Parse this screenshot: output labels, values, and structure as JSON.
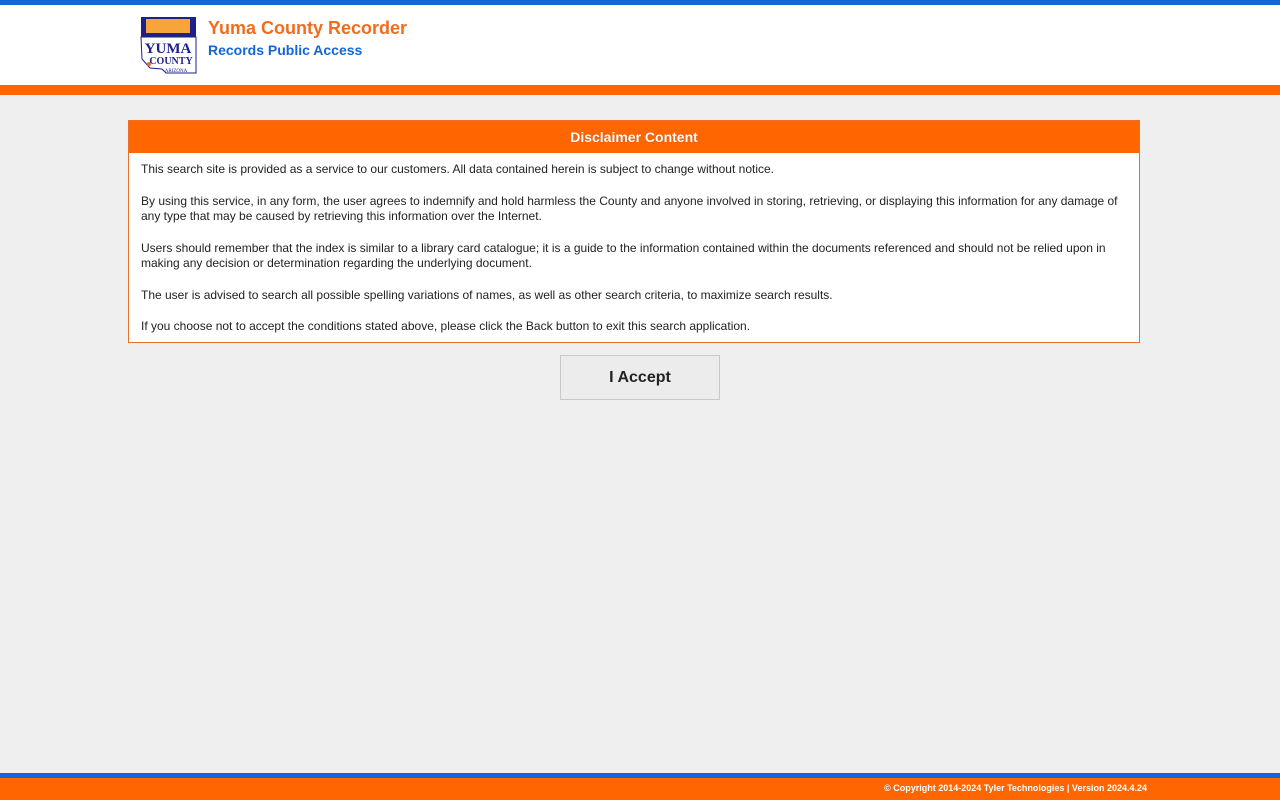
{
  "header": {
    "title": "Yuma County Recorder",
    "subtitle": "Records Public Access",
    "logo": {
      "icon": "yuma-county-seal",
      "text_line1": "YUMA",
      "text_line2": "COUNTY",
      "text_line3": "ARIZONA"
    }
  },
  "disclaimer": {
    "heading": "Disclaimer Content",
    "paragraphs": [
      "This search site is provided as a service to our customers. All data contained herein is subject to change without notice.",
      "By using this service, in any form, the user agrees to indemnify and hold harmless the County and anyone involved in storing, retrieving, or displaying this information for any damage of any type that may be caused by retrieving this information over the Internet.",
      "Users should remember that the index is similar to a library card catalogue; it is a guide to the information contained within the documents referenced and should not be relied upon in making any decision or determination regarding the underlying document.",
      "The user is advised to search all possible spelling variations of names, as well as other search criteria, to maximize search results.",
      "If you choose not to accept the conditions stated above, please click the Back button to exit this search application."
    ]
  },
  "actions": {
    "accept_label": "I Accept"
  },
  "footer": {
    "copyright": "© Copyright 2014-2024 Tyler Technologies | Version 2024.4.24"
  },
  "colors": {
    "accent_orange": "#ff6600",
    "accent_blue": "#1466d8",
    "title_orange": "#f36c1c"
  }
}
